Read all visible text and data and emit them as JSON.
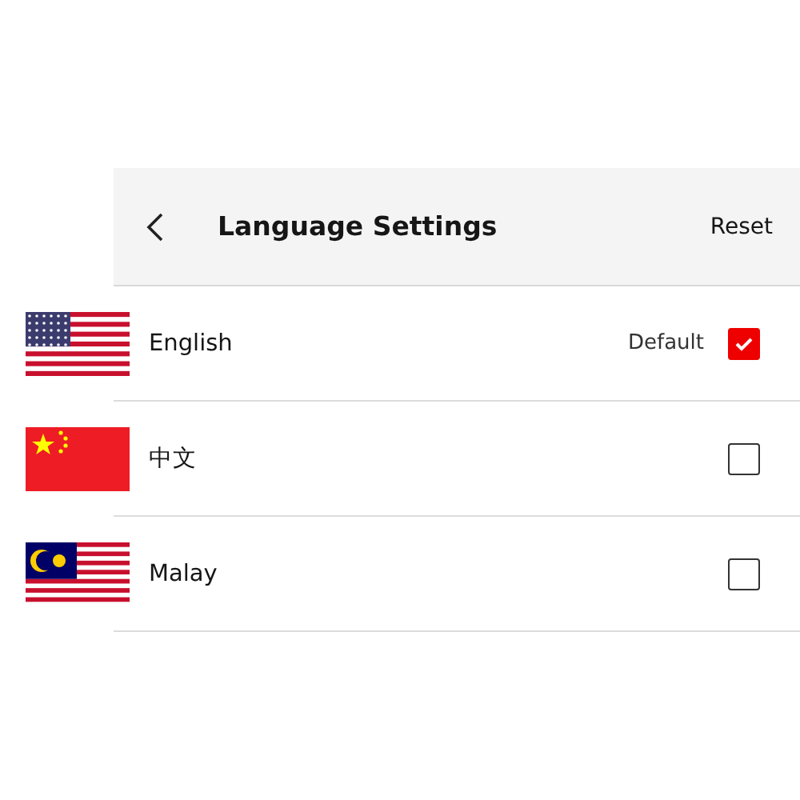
{
  "header": {
    "title": "Language Settings",
    "action": "Reset"
  },
  "languages": [
    {
      "kind": "us",
      "name": "English",
      "note": "Default",
      "checked": true
    },
    {
      "kind": "cn",
      "name": "中文",
      "checked": false
    },
    {
      "kind": "my",
      "name": "Malay",
      "checked": false
    }
  ]
}
